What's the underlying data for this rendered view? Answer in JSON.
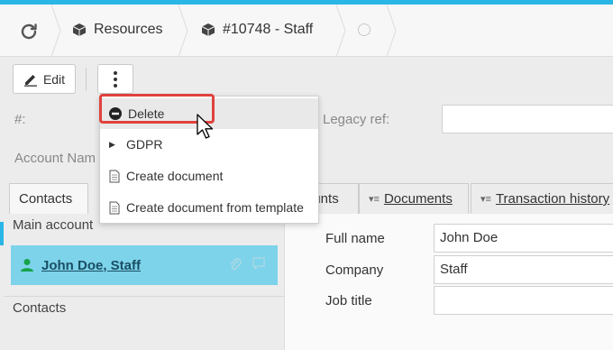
{
  "breadcrumb": {
    "items": [
      {
        "label": "Resources",
        "icon": "cube-icon"
      },
      {
        "label": "#10748 - Staff",
        "icon": "cube-icon"
      }
    ]
  },
  "toolbar": {
    "edit_label": "Edit",
    "more_icon": "vertical-ellipsis-icon"
  },
  "form": {
    "id_label": "#:",
    "legacy_ref_label": "Legacy ref:",
    "account_name_label": "Account Nam"
  },
  "tabs": [
    {
      "label": "Contacts",
      "active": true
    },
    {
      "label": "ounts",
      "active": false
    },
    {
      "label": "Documents",
      "active": false
    },
    {
      "label": "Transaction history",
      "active": false
    }
  ],
  "left_pane": {
    "main_account_label": "Main account",
    "contact_name": "John Doe, Staff",
    "contacts_label": "Contacts"
  },
  "details": {
    "full_name_label": "Full name",
    "full_name_value": "John Doe",
    "company_label": "Company",
    "company_value": "Staff",
    "job_title_label": "Job title",
    "job_title_value": ""
  },
  "menu": {
    "items": [
      {
        "label": "Delete",
        "icon": "no-entry-icon"
      },
      {
        "label": "GDPR",
        "icon": "triangle-right-icon"
      },
      {
        "label": "Create document",
        "icon": "document-icon"
      },
      {
        "label": "Create document from template",
        "icon": "document-icon"
      }
    ]
  },
  "colors": {
    "accent": "#29b6e6",
    "selected_card": "#7dd3ea",
    "highlight_border": "#e0423d"
  }
}
